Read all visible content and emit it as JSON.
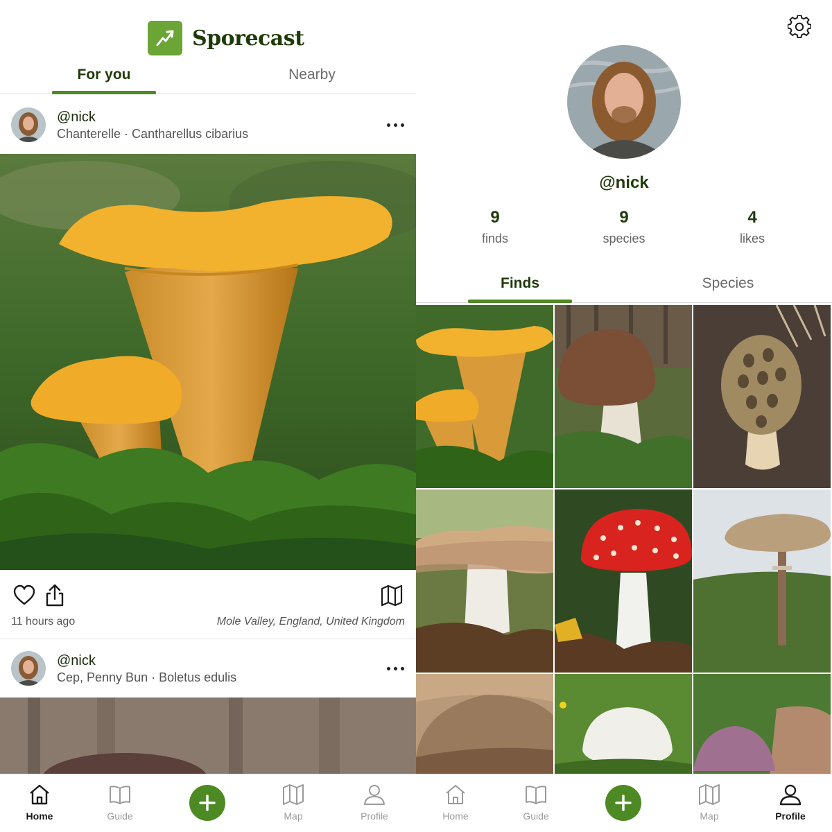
{
  "app": {
    "name": "Sporecast",
    "brand_color": "#4e8a24"
  },
  "feed": {
    "tabs": [
      {
        "label": "For you",
        "active": true
      },
      {
        "label": "Nearby",
        "active": false
      }
    ],
    "posts": [
      {
        "user": "@nick",
        "species": "Chanterelle · Cantharellus cibarius",
        "time": "11 hours ago",
        "location": "Mole Valley, England, United Kingdom"
      },
      {
        "user": "@nick",
        "species": "Cep, Penny Bun · Boletus edulis"
      }
    ]
  },
  "profile": {
    "username": "@nick",
    "stats": [
      {
        "value": "9",
        "label": "finds"
      },
      {
        "value": "9",
        "label": "species"
      },
      {
        "value": "4",
        "label": "likes"
      }
    ],
    "tabs": [
      {
        "label": "Finds",
        "active": true
      },
      {
        "label": "Species",
        "active": false
      }
    ],
    "finds_icons": [
      "chanterelle-photo",
      "cep-photo",
      "morel-photo",
      "hedgehog-mushroom-photo",
      "fly-agaric-photo",
      "parasol-mushroom-photo",
      "brown-cap-photo",
      "white-mushroom-photo",
      "purple-cap-photo"
    ]
  },
  "nav_left": {
    "items": [
      {
        "label": "Home",
        "icon": "home-icon",
        "active": true
      },
      {
        "label": "Guide",
        "icon": "book-icon",
        "active": false
      },
      {
        "label": "Map",
        "icon": "map-icon",
        "active": false
      },
      {
        "label": "Profile",
        "icon": "user-icon",
        "active": false
      }
    ]
  },
  "nav_right": {
    "items": [
      {
        "label": "Home",
        "icon": "home-icon",
        "active": false
      },
      {
        "label": "Guide",
        "icon": "book-icon",
        "active": false
      },
      {
        "label": "Map",
        "icon": "map-icon",
        "active": false
      },
      {
        "label": "Profile",
        "icon": "user-icon",
        "active": true
      }
    ]
  }
}
